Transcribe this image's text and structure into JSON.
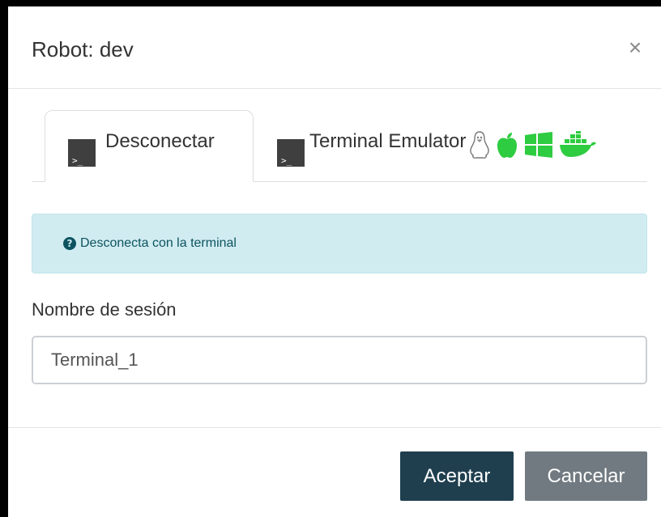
{
  "modal": {
    "title": "Robot: dev",
    "close_label": "×"
  },
  "tabs": [
    {
      "label": "Desconectar",
      "icon": "terminal-icon",
      "active": true
    },
    {
      "label": "Terminal Emulator",
      "icon": "terminal-icon",
      "active": false,
      "os_icons": [
        "linux-icon",
        "apple-icon",
        "windows-icon",
        "docker-icon"
      ]
    }
  ],
  "alert": {
    "icon": "question-circle-icon",
    "text": "Desconecta con la terminal"
  },
  "session_field": {
    "label": "Nombre de sesión",
    "value": "Terminal_1"
  },
  "footer": {
    "accept_label": "Aceptar",
    "cancel_label": "Cancelar"
  },
  "colors": {
    "os_icon_green": "#2ecc40",
    "accept_bg": "#1f3f4f",
    "cancel_bg": "#707a80",
    "alert_bg": "#d1ecf1",
    "alert_text": "#0c5460"
  }
}
